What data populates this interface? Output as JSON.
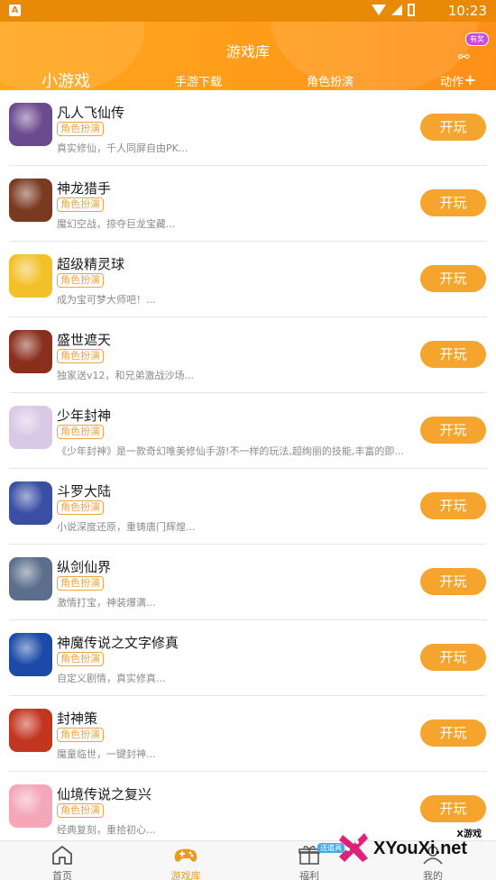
{
  "status_bar": {
    "app_indicator": "A",
    "time": "10:23"
  },
  "header": {
    "title": "游戏库",
    "action_badge": "有奖",
    "tabs": [
      {
        "label": "小游戏",
        "active": true
      },
      {
        "label": "手游下载",
        "active": false
      },
      {
        "label": "角色扮演",
        "active": false
      },
      {
        "label": "动作",
        "active": false
      }
    ]
  },
  "games": [
    {
      "title": "凡人飞仙传",
      "tag": "角色扮演",
      "desc": "真实修仙，千人同屏自由PK...",
      "button": "开玩",
      "icon_color": "#6c4a8f"
    },
    {
      "title": "神龙猎手",
      "tag": "角色扮演",
      "desc": "魔幻空战，掠夺巨龙宝藏...",
      "button": "开玩",
      "icon_color": "#7a3a22"
    },
    {
      "title": "超级精灵球",
      "tag": "角色扮演",
      "desc": "成为宝可梦大师吧！...",
      "button": "开玩",
      "icon_color": "#f2c12a"
    },
    {
      "title": "盛世遮天",
      "tag": "角色扮演",
      "desc": "独家送v12，和兄弟激战沙场...",
      "button": "开玩",
      "icon_color": "#8a2f1c"
    },
    {
      "title": "少年封神",
      "tag": "角色扮演",
      "desc": "《少年封神》是一款奇幻唯美修仙手游!不一样的玩法,超绚丽的技能,丰富的即...",
      "button": "开玩",
      "icon_color": "#d9c8e6"
    },
    {
      "title": "斗罗大陆",
      "tag": "角色扮演",
      "desc": "小说深度还原，重铸唐门辉煌...",
      "button": "开玩",
      "icon_color": "#3a4fa3"
    },
    {
      "title": "纵剑仙界",
      "tag": "角色扮演",
      "desc": "激情打宝，神装爆满...",
      "button": "开玩",
      "icon_color": "#5b6e8c"
    },
    {
      "title": "神魔传说之文字修真",
      "tag": "角色扮演",
      "desc": "自定义剧情，真实修真...",
      "button": "开玩",
      "icon_color": "#1c4aa8"
    },
    {
      "title": "封神策",
      "tag": "角色扮演",
      "desc": "魔童临世，一键封神...",
      "button": "开玩",
      "icon_color": "#c2351f"
    },
    {
      "title": "仙境传说之复兴",
      "tag": "角色扮演",
      "desc": "经典复刻，重拾初心...",
      "button": "开玩",
      "icon_color": "#f3a7b8"
    }
  ],
  "bottom_nav": [
    {
      "label": "首页",
      "icon": "home-icon",
      "active": false
    },
    {
      "label": "游戏库",
      "icon": "gamepad-icon",
      "active": true
    },
    {
      "label": "福利",
      "icon": "gift-icon",
      "active": false,
      "badge": "送道具"
    },
    {
      "label": "我的",
      "icon": "user-icon",
      "active": false
    }
  ],
  "watermark": {
    "small": "X游戏",
    "text": "XYouXi.net"
  },
  "colors": {
    "brand": "#ff9d1a",
    "button": "#f5a42e",
    "tag": "#f2a341",
    "status_bar": "#e98a07"
  }
}
